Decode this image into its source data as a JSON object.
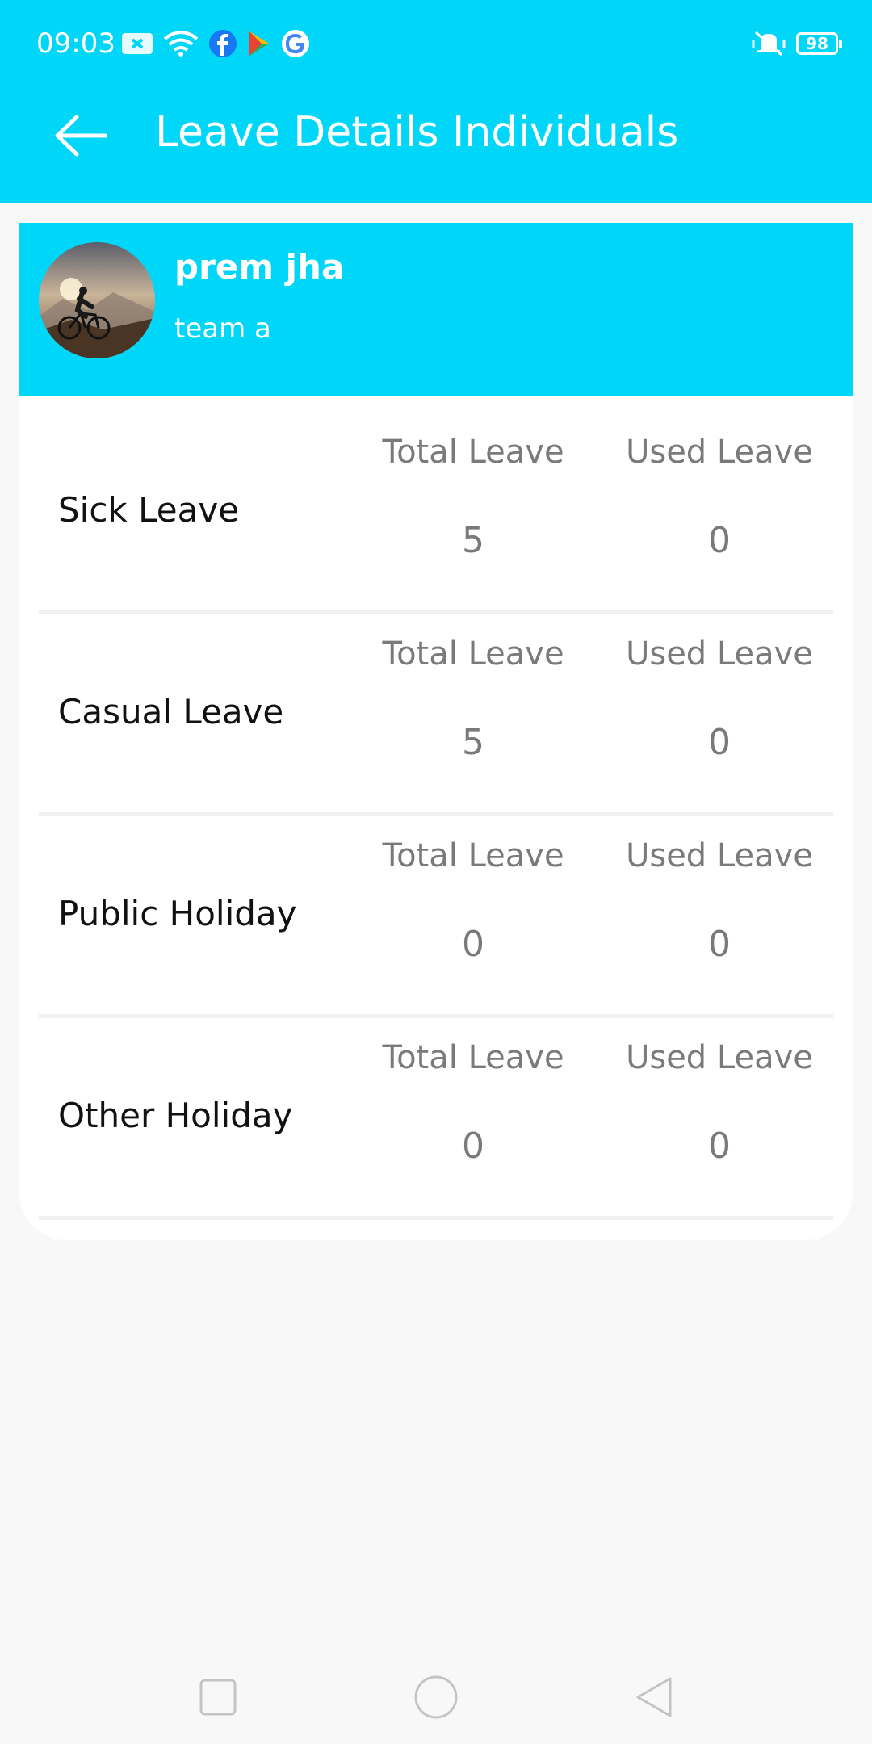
{
  "status_bar": {
    "time": "09:03",
    "battery": "98",
    "icons_left": [
      "mail-icon",
      "wifi-icon",
      "facebook-icon",
      "play-store-icon",
      "google-icon"
    ],
    "icons_right": [
      "vibrate-icon",
      "battery-icon"
    ]
  },
  "header": {
    "title": "Leave Details Individuals",
    "back_icon": "arrow-left-icon"
  },
  "profile": {
    "name": "prem jha",
    "team": "team a",
    "avatar": "cyclist-photo"
  },
  "columns": {
    "total_label": "Total Leave",
    "used_label": "Used Leave"
  },
  "leaves": [
    {
      "type": "Sick Leave",
      "total": "5",
      "used": "0"
    },
    {
      "type": "Casual Leave",
      "total": "5",
      "used": "0"
    },
    {
      "type": "Public Holiday",
      "total": "0",
      "used": "0"
    },
    {
      "type": "Other Holiday",
      "total": "0",
      "used": "0"
    }
  ],
  "colors": {
    "accent": "#00d6f8",
    "background": "#f8f8f8",
    "card": "#ffffff",
    "muted_text": "#7a7a7a"
  },
  "nav_bar": {
    "icons": [
      "recent-apps-icon",
      "home-icon",
      "back-icon"
    ]
  }
}
